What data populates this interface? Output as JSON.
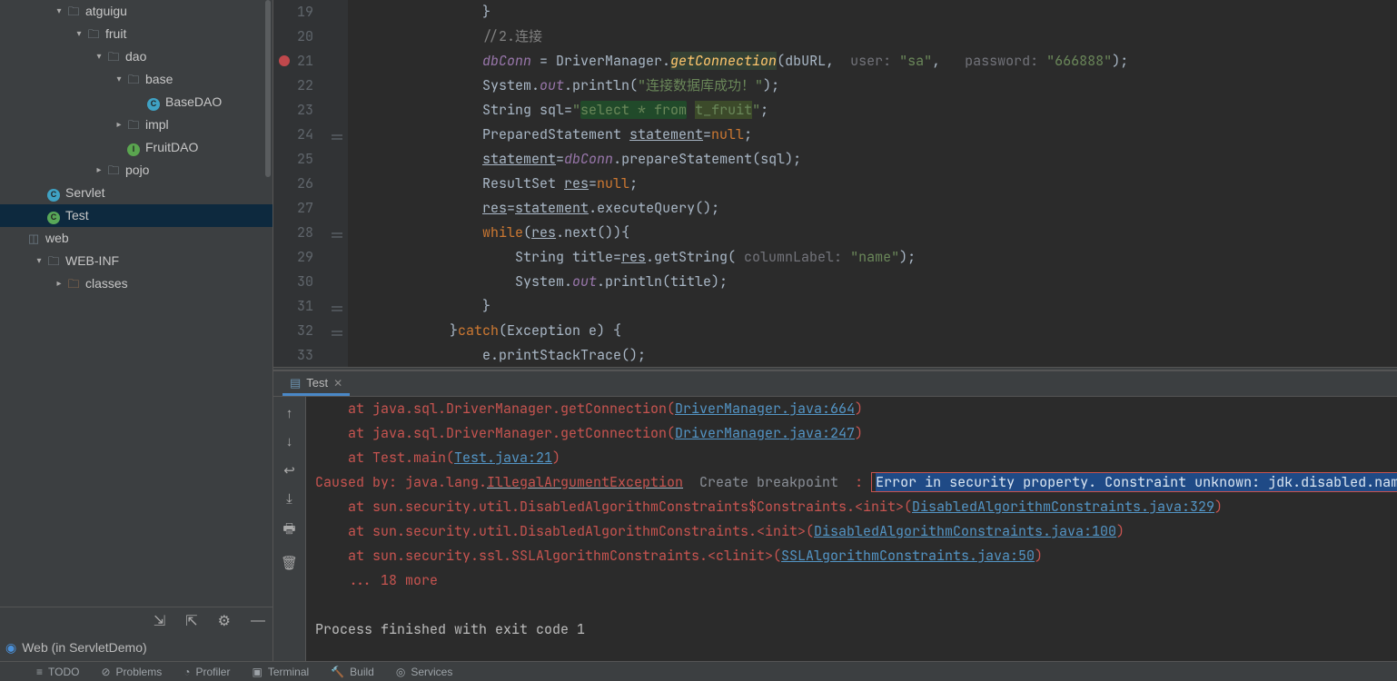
{
  "tree": {
    "items": [
      {
        "depth": 2,
        "chev": "▾",
        "icon": "folder",
        "label": "atguigu"
      },
      {
        "depth": 3,
        "chev": "▾",
        "icon": "folder",
        "label": "fruit"
      },
      {
        "depth": 4,
        "chev": "▾",
        "icon": "folder",
        "label": "dao"
      },
      {
        "depth": 5,
        "chev": "▾",
        "icon": "folder",
        "label": "base"
      },
      {
        "depth": 6,
        "chev": "",
        "icon": "class-c",
        "label": "BaseDAO"
      },
      {
        "depth": 5,
        "chev": "▸",
        "icon": "folder",
        "label": "impl"
      },
      {
        "depth": 5,
        "chev": "",
        "icon": "class-i",
        "label": "FruitDAO"
      },
      {
        "depth": 4,
        "chev": "▸",
        "icon": "folder",
        "label": "pojo"
      },
      {
        "depth": 1,
        "chev": "",
        "icon": "class-c",
        "label": "Servlet"
      },
      {
        "depth": 1,
        "chev": "",
        "icon": "class-t",
        "label": "Test",
        "selected": true
      },
      {
        "depth": 0,
        "chev": "",
        "icon": "web",
        "label": "web"
      },
      {
        "depth": 1,
        "chev": "▾",
        "icon": "folder",
        "label": "WEB-INF"
      },
      {
        "depth": 2,
        "chev": "▸",
        "icon": "orange-folder",
        "label": "classes"
      }
    ]
  },
  "scope": {
    "label": "Web (in ServletDemo)"
  },
  "editor": {
    "startLine": 19,
    "breakpointLine": 21,
    "lines": [
      {
        "n": 19,
        "html": "            }"
      },
      {
        "n": 20,
        "html": "            <span class='com'>//2.连接</span>"
      },
      {
        "n": 21,
        "html": "            <span class='field'>dbConn</span> = DriverManager.<span class='method-call connhl'>getConnection</span>(dbURL,  <span class='param'>user:</span> <span class='str'>\"sa\"</span>,   <span class='param'>password:</span> <span class='str'>\"666888\"</span>);",
        "hl": true
      },
      {
        "n": 22,
        "html": "            System.<span class='field'>out</span>.println(<span class='str'>\"连接数据库成功！\"</span>);"
      },
      {
        "n": 23,
        "html": "            String sql=<span class='str'>\"</span><span class='str sqlhl'>select * from</span> <span class='str sqlhl2'>t_fruit</span><span class='str'>\"</span>;"
      },
      {
        "n": 24,
        "html": "            PreparedStatement <span class='underline'>statement</span>=<span class='kw'>null</span>;"
      },
      {
        "n": 25,
        "html": "            <span class='underline'>statement</span>=<span class='field'>dbConn</span>.prepareStatement(sql);"
      },
      {
        "n": 26,
        "html": "            ResultSet <span class='underline'>res</span>=<span class='kw'>null</span>;"
      },
      {
        "n": 27,
        "html": "            <span class='underline'>res</span>=<span class='underline'>statement</span>.executeQuery();"
      },
      {
        "n": 28,
        "html": "            <span class='kw'>while</span>(<span class='underline'>res</span>.next()){"
      },
      {
        "n": 29,
        "html": "                String title=<span class='underline'>res</span>.getString( <span class='param'>columnLabel:</span> <span class='str'>\"name\"</span>);"
      },
      {
        "n": 30,
        "html": "                System.<span class='field'>out</span>.println(title);"
      },
      {
        "n": 31,
        "html": "            }"
      },
      {
        "n": 32,
        "html": "        }<span class='kw'>catch</span>(Exception e) {"
      },
      {
        "n": 33,
        "html": "            e.printStackTrace();"
      }
    ]
  },
  "console": {
    "tab": "Test",
    "lines": [
      {
        "html": "    <span class='err'>at java.sql.DriverManager.getConnection(</span><span class='link'>DriverManager.java:664</span><span class='err'>)</span>"
      },
      {
        "html": "    <span class='err'>at java.sql.DriverManager.getConnection(</span><span class='link'>DriverManager.java:247</span><span class='err'>)</span>"
      },
      {
        "html": "    <span class='err'>at Test.main(</span><span class='link'>Test.java:21</span><span class='err'>)</span>"
      },
      {
        "html": "<span class='err'>Caused by: java.lang.</span><span class='err underline'>IllegalArgumentException</span>  <span class='cbp'>Create breakpoint</span>  <span class='err'>:</span> <span class='redbox'><span class='selerr'>Error in security property. Constraint unknown: jdk.disabled.namedCurves</span></span>"
      },
      {
        "html": "    <span class='err'>at sun.security.util.DisabledAlgorithmConstraints$Constraints.&lt;init&gt;(</span><span class='link'>DisabledAlgorithmConstraints.java:329</span><span class='err'>)</span>"
      },
      {
        "html": "    <span class='err'>at sun.security.util.DisabledAlgorithmConstraints.&lt;init&gt;(</span><span class='link'>DisabledAlgorithmConstraints.java:100</span><span class='err'>)</span>"
      },
      {
        "html": "    <span class='err'>at sun.security.ssl.SSLAlgorithmConstraints.&lt;clinit&gt;(</span><span class='link'>SSLAlgorithmConstraints.java:50</span><span class='err'>)</span>"
      },
      {
        "html": "    <span class='err'>... 18 more</span>"
      },
      {
        "html": ""
      },
      {
        "html": "Process finished with exit code 1"
      }
    ]
  },
  "status": {
    "items": [
      "TODO",
      "Problems",
      "Profiler",
      "Terminal",
      "Build",
      "Services"
    ]
  }
}
